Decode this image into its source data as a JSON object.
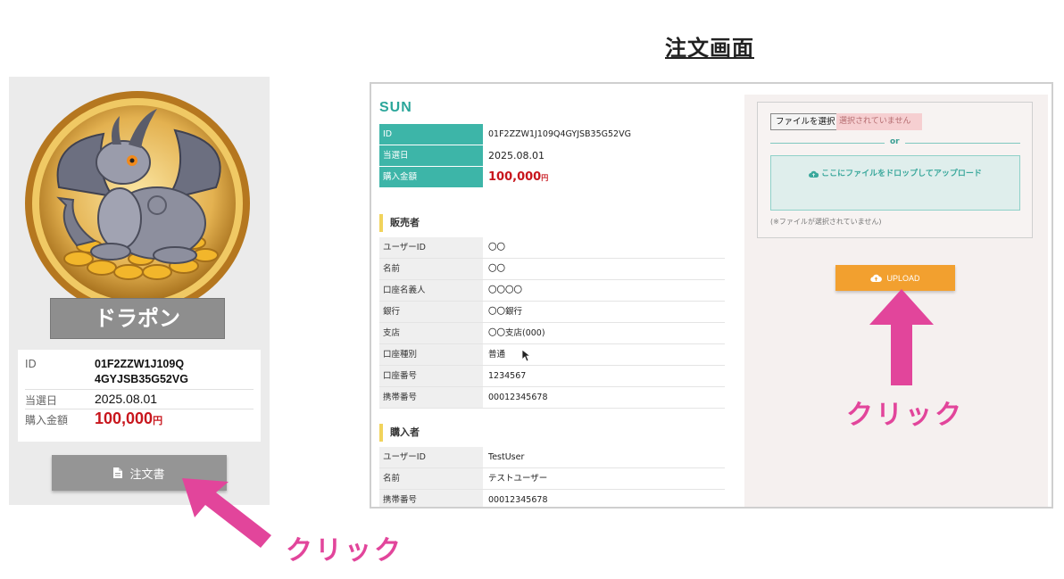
{
  "heading": "注文画面",
  "card": {
    "name": "ドラポン",
    "rows": [
      {
        "key": "ID",
        "value_line1": "01F2ZZW1J109Q",
        "value_line2": "4GYJSB35G52VG"
      },
      {
        "key": "当選日",
        "value": "2025.08.01"
      },
      {
        "key": "購入金額",
        "value": "100,000",
        "unit": "円"
      }
    ],
    "order_button": "注文書"
  },
  "annotations": {
    "click_left": "クリック",
    "click_right": "クリック"
  },
  "screen": {
    "logo": "SUN",
    "summary": [
      {
        "key": "ID",
        "value": "01F2ZZW1J109Q4GYJSB35G52VG"
      },
      {
        "key": "当選日",
        "value": "2025.08.01"
      },
      {
        "key": "購入金額",
        "value": "100,000",
        "unit": "円"
      }
    ],
    "seller_title": "販売者",
    "seller": [
      {
        "key": "ユーザーID",
        "value": "〇〇"
      },
      {
        "key": "名前",
        "value": "〇〇"
      },
      {
        "key": "口座名義人",
        "value": "〇〇〇〇"
      },
      {
        "key": "銀行",
        "value": "〇〇銀行"
      },
      {
        "key": "支店",
        "value": "〇〇支店(000)"
      },
      {
        "key": "口座種別",
        "value": "普通"
      },
      {
        "key": "口座番号",
        "value": "1234567"
      },
      {
        "key": "携帯番号",
        "value": "00012345678"
      }
    ],
    "buyer_title": "購入者",
    "buyer": [
      {
        "key": "ユーザーID",
        "value": "TestUser"
      },
      {
        "key": "名前",
        "value": "テストユーザー"
      },
      {
        "key": "携帯番号",
        "value": "00012345678"
      }
    ],
    "upload": {
      "file_button": "ファイルを選択",
      "file_status": "選択されていません",
      "or": "or",
      "drop_text": "ここにファイルをドロップしてアップロード",
      "note": "(※ファイルが選択されていません)",
      "upload_button": "UPLOAD"
    }
  },
  "colors": {
    "teal": "#3db5a8",
    "amount_red": "#c8161d",
    "annotation_pink": "#e2459b",
    "upload_orange": "#f2a02f",
    "card_grey": "#959595"
  },
  "icons": [
    "dragon-medal-icon",
    "document-icon",
    "cloud-upload-icon",
    "mouse-cursor-icon",
    "arrow-icon"
  ]
}
